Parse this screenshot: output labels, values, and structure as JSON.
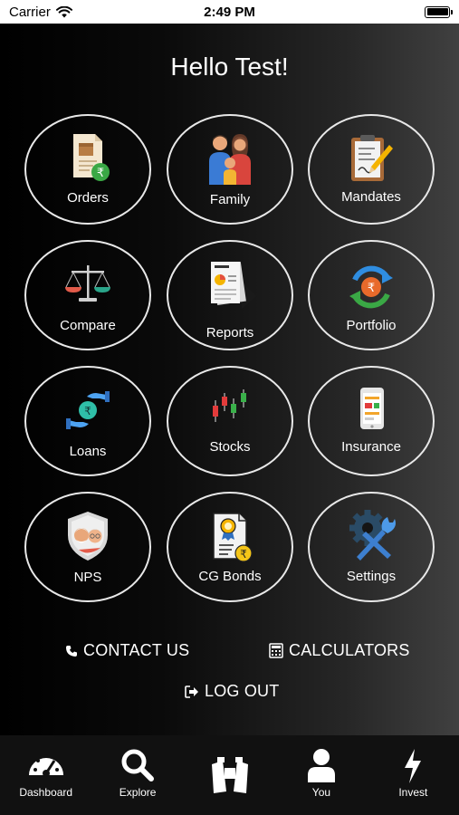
{
  "status_bar": {
    "carrier": "Carrier",
    "time": "2:49 PM"
  },
  "greeting": "Hello Test!",
  "tiles": [
    {
      "label": "Orders",
      "icon": "orders-icon"
    },
    {
      "label": "Family",
      "icon": "family-icon"
    },
    {
      "label": "Mandates",
      "icon": "mandates-icon"
    },
    {
      "label": "Compare",
      "icon": "scales-icon"
    },
    {
      "label": "Reports",
      "icon": "reports-icon"
    },
    {
      "label": "Portfolio",
      "icon": "portfolio-icon"
    },
    {
      "label": "Loans",
      "icon": "loans-icon"
    },
    {
      "label": "Stocks",
      "icon": "stocks-icon"
    },
    {
      "label": "Insurance",
      "icon": "insurance-icon"
    },
    {
      "label": "NPS",
      "icon": "nps-icon"
    },
    {
      "label": "CG Bonds",
      "icon": "cg-bonds-icon"
    },
    {
      "label": "Settings",
      "icon": "settings-icon"
    }
  ],
  "links": {
    "contact": "CONTACT US",
    "calculators": "CALCULATORS",
    "logout": "LOG OUT"
  },
  "tabs": [
    {
      "label": "Dashboard",
      "icon": "dashboard-icon"
    },
    {
      "label": "Explore",
      "icon": "search-icon"
    },
    {
      "label": "",
      "icon": "binoculars-icon"
    },
    {
      "label": "You",
      "icon": "user-icon"
    },
    {
      "label": "Invest",
      "icon": "bolt-icon"
    }
  ],
  "colors": {
    "tile_border": "#e8e8e8",
    "tab_bar": "#111111",
    "rupee_green": "#3aa845",
    "rupee_gold": "#f5c518"
  }
}
